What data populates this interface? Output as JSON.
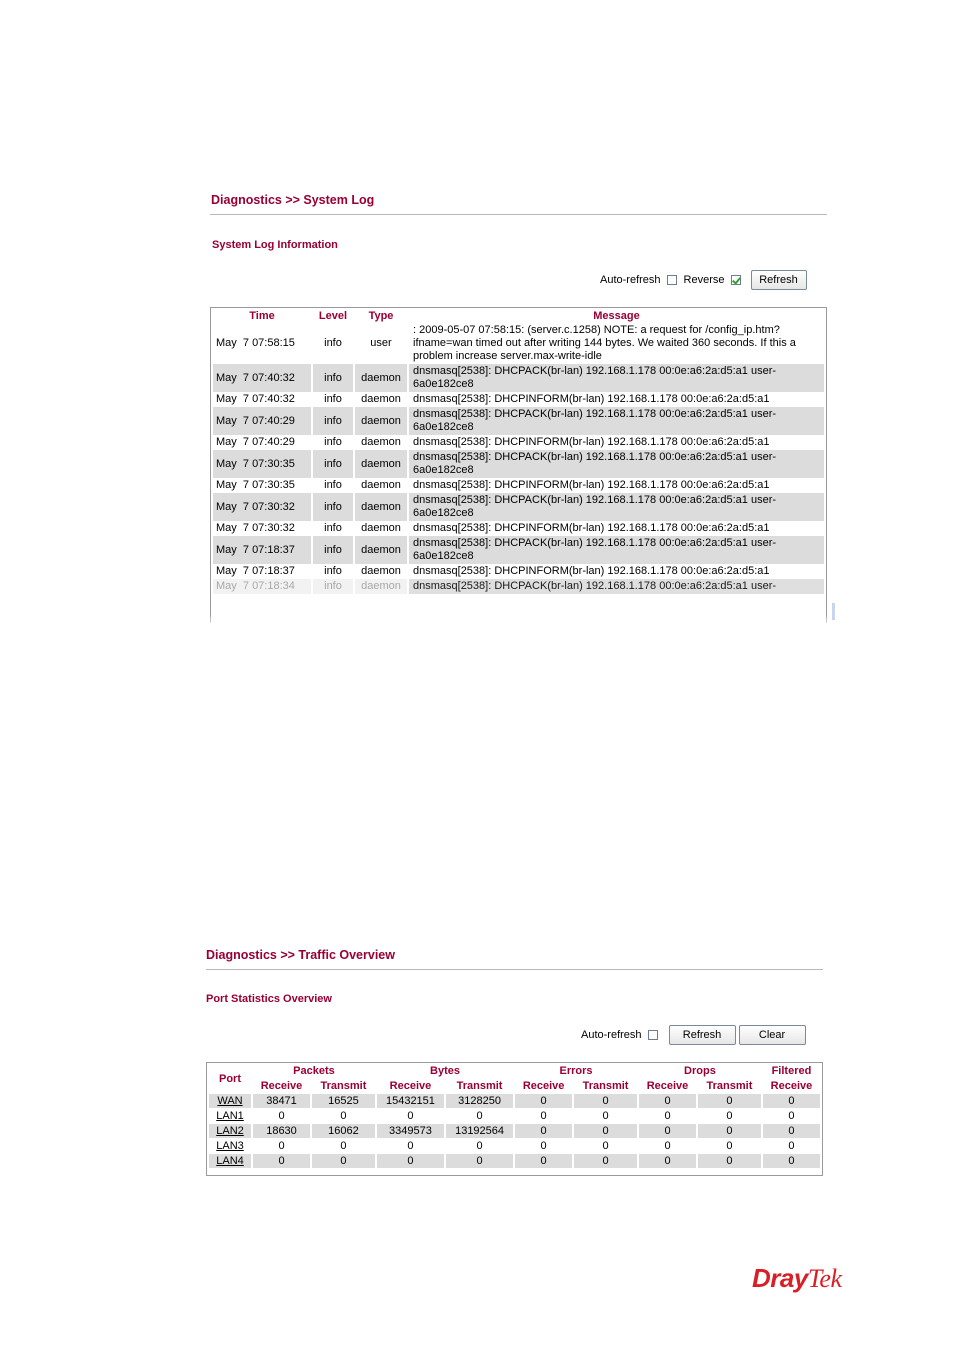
{
  "system_log": {
    "breadcrumb": "Diagnostics >> System Log",
    "subtitle": "System Log Information",
    "controls": {
      "auto_refresh_label": "Auto-refresh",
      "auto_refresh_checked": false,
      "reverse_label": "Reverse",
      "reverse_checked": true,
      "refresh_button": "Refresh"
    },
    "columns": [
      "Time",
      "Level",
      "Type",
      "Message"
    ],
    "rows": [
      {
        "time": "May  7 07:58:15",
        "level": "info",
        "type": "user",
        "message": ": 2009-05-07 07:58:15: (server.c.1258) NOTE: a request for /config_ip.htm?ifname=wan timed out after writing 144 bytes. We waited 360 seconds. If this a problem increase server.max-write-idle"
      },
      {
        "time": "May  7 07:40:32",
        "level": "info",
        "type": "daemon",
        "message": "dnsmasq[2538]: DHCPACK(br-lan) 192.168.1.178 00:0e:a6:2a:d5:a1 user-6a0e182ce8"
      },
      {
        "time": "May  7 07:40:32",
        "level": "info",
        "type": "daemon",
        "message": "dnsmasq[2538]: DHCPINFORM(br-lan) 192.168.1.178 00:0e:a6:2a:d5:a1"
      },
      {
        "time": "May  7 07:40:29",
        "level": "info",
        "type": "daemon",
        "message": "dnsmasq[2538]: DHCPACK(br-lan) 192.168.1.178 00:0e:a6:2a:d5:a1 user-6a0e182ce8"
      },
      {
        "time": "May  7 07:40:29",
        "level": "info",
        "type": "daemon",
        "message": "dnsmasq[2538]: DHCPINFORM(br-lan) 192.168.1.178 00:0e:a6:2a:d5:a1"
      },
      {
        "time": "May  7 07:30:35",
        "level": "info",
        "type": "daemon",
        "message": "dnsmasq[2538]: DHCPACK(br-lan) 192.168.1.178 00:0e:a6:2a:d5:a1 user-6a0e182ce8"
      },
      {
        "time": "May  7 07:30:35",
        "level": "info",
        "type": "daemon",
        "message": "dnsmasq[2538]: DHCPINFORM(br-lan) 192.168.1.178 00:0e:a6:2a:d5:a1"
      },
      {
        "time": "May  7 07:30:32",
        "level": "info",
        "type": "daemon",
        "message": "dnsmasq[2538]: DHCPACK(br-lan) 192.168.1.178 00:0e:a6:2a:d5:a1 user-6a0e182ce8"
      },
      {
        "time": "May  7 07:30:32",
        "level": "info",
        "type": "daemon",
        "message": "dnsmasq[2538]: DHCPINFORM(br-lan) 192.168.1.178 00:0e:a6:2a:d5:a1"
      },
      {
        "time": "May  7 07:18:37",
        "level": "info",
        "type": "daemon",
        "message": "dnsmasq[2538]: DHCPACK(br-lan) 192.168.1.178 00:0e:a6:2a:d5:a1 user-6a0e182ce8"
      },
      {
        "time": "May  7 07:18:37",
        "level": "info",
        "type": "daemon",
        "message": "dnsmasq[2538]: DHCPINFORM(br-lan) 192.168.1.178 00:0e:a6:2a:d5:a1"
      },
      {
        "time": "May  7 07:18:34",
        "level": "info",
        "type": "daemon",
        "message": "dnsmasq[2538]: DHCPACK(br-lan) 192.168.1.178 00:0e:a6:2a:d5:a1 user-"
      }
    ]
  },
  "traffic_overview": {
    "breadcrumb": "Diagnostics >> Traffic Overview",
    "subtitle": "Port Statistics Overview",
    "controls": {
      "auto_refresh_label": "Auto-refresh",
      "auto_refresh_checked": false,
      "refresh_button": "Refresh",
      "clear_button": "Clear"
    },
    "group_headers": {
      "port": "Port",
      "packets": "Packets",
      "bytes": "Bytes",
      "errors": "Errors",
      "drops": "Drops",
      "filtered": "Filtered"
    },
    "sub_headers": [
      "Receive",
      "Transmit",
      "Receive",
      "Transmit",
      "Receive",
      "Transmit",
      "Receive",
      "Transmit",
      "Receive"
    ],
    "rows": [
      {
        "port": "WAN",
        "values": [
          "38471",
          "16525",
          "15432151",
          "3128250",
          "0",
          "0",
          "0",
          "0",
          "0"
        ]
      },
      {
        "port": "LAN1",
        "values": [
          "0",
          "0",
          "0",
          "0",
          "0",
          "0",
          "0",
          "0",
          "0"
        ]
      },
      {
        "port": "LAN2",
        "values": [
          "18630",
          "16062",
          "3349573",
          "13192564",
          "0",
          "0",
          "0",
          "0",
          "0"
        ]
      },
      {
        "port": "LAN3",
        "values": [
          "0",
          "0",
          "0",
          "0",
          "0",
          "0",
          "0",
          "0",
          "0"
        ]
      },
      {
        "port": "LAN4",
        "values": [
          "0",
          "0",
          "0",
          "0",
          "0",
          "0",
          "0",
          "0",
          "0"
        ]
      }
    ]
  },
  "footer": {
    "logo_part1": "Dray",
    "logo_part2": "Tek",
    "brand_color": "#d91f26"
  }
}
